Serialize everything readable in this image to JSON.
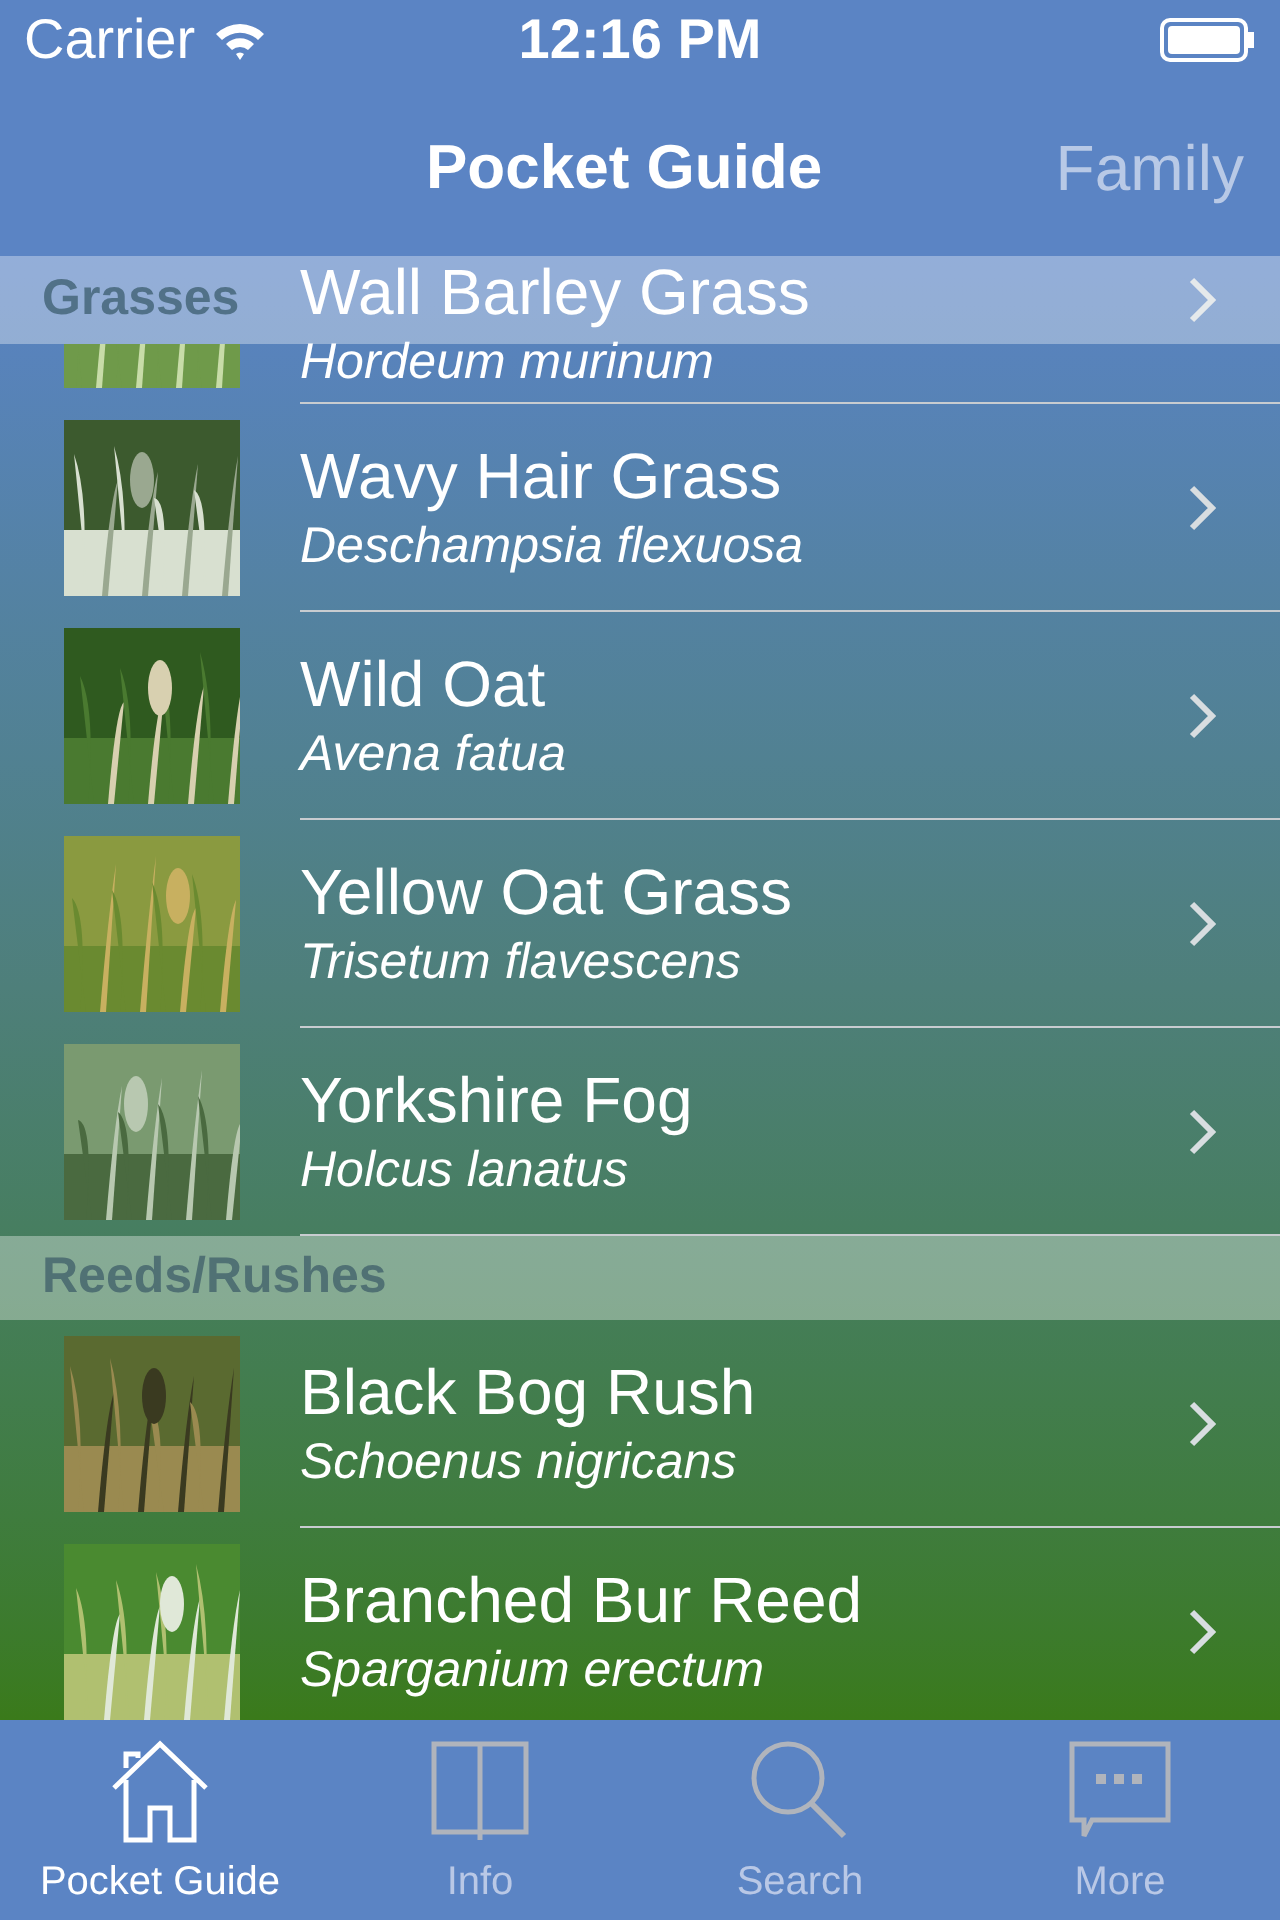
{
  "status_bar": {
    "carrier": "Carrier",
    "time": "12:16 PM"
  },
  "nav_bar": {
    "title": "Pocket Guide",
    "right_button": "Family"
  },
  "sections": [
    {
      "title": "Grasses",
      "items": [
        {
          "name": "Wall Barley Grass",
          "latin": "Hordeum murinum"
        },
        {
          "name": "Wavy Hair Grass",
          "latin": "Deschampsia flexuosa"
        },
        {
          "name": "Wild Oat",
          "latin": "Avena fatua"
        },
        {
          "name": "Yellow Oat Grass",
          "latin": "Trisetum flavescens"
        },
        {
          "name": "Yorkshire Fog",
          "latin": "Holcus lanatus"
        }
      ]
    },
    {
      "title": "Reeds/Rushes",
      "items": [
        {
          "name": "Black Bog Rush",
          "latin": "Schoenus nigricans"
        },
        {
          "name": "Branched Bur Reed",
          "latin": "Sparganium erectum"
        }
      ]
    }
  ],
  "tabs": [
    {
      "label": "Pocket Guide",
      "selected": true
    },
    {
      "label": "Info",
      "selected": false
    },
    {
      "label": "Search",
      "selected": false
    },
    {
      "label": "More",
      "selected": false
    }
  ]
}
